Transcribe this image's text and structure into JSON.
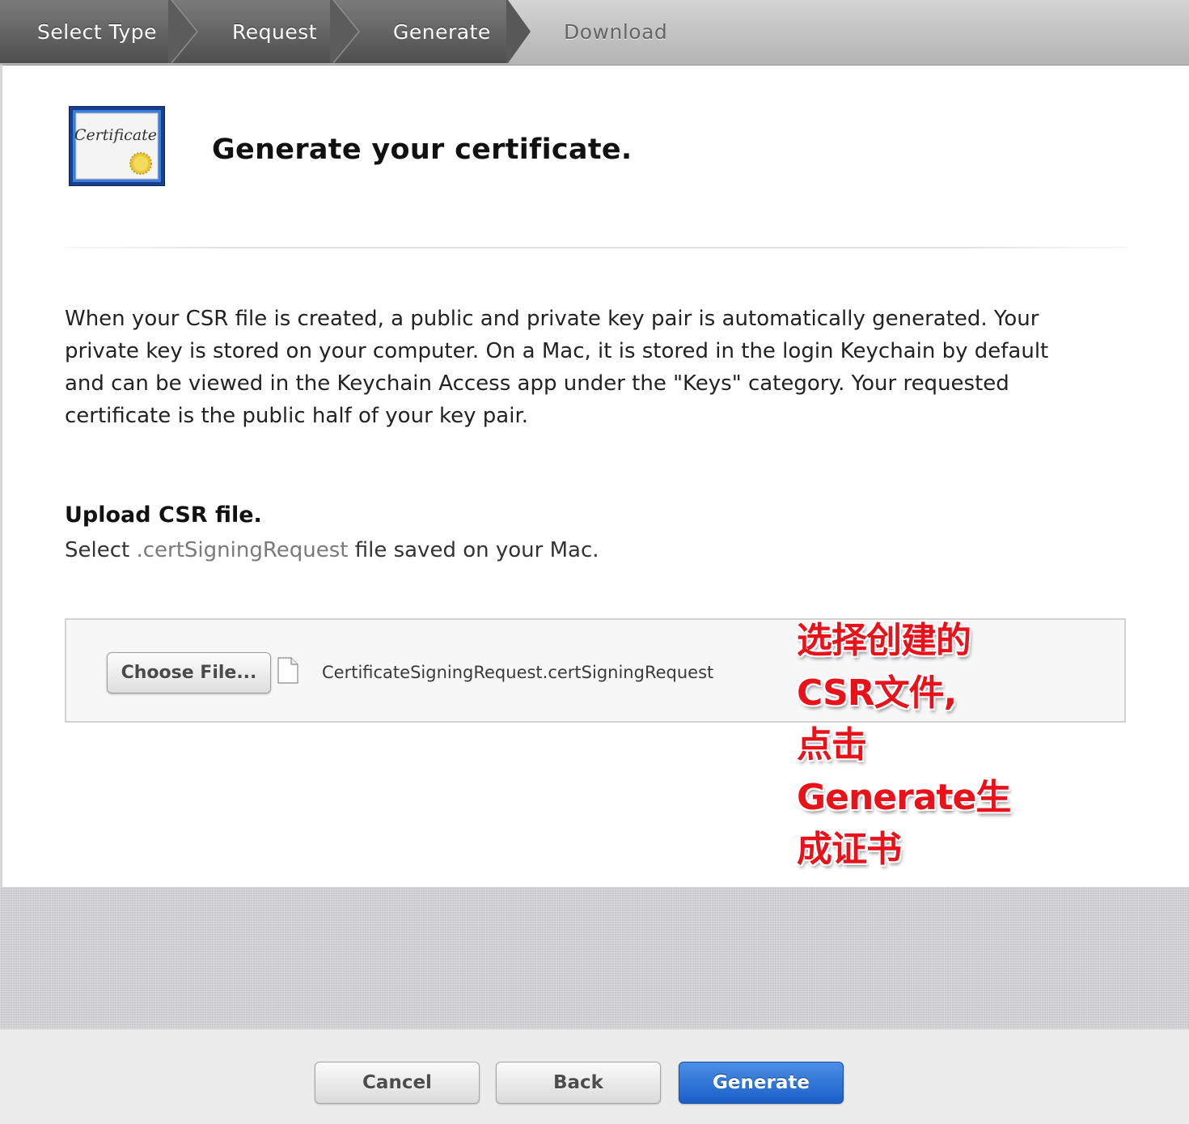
{
  "wizard": {
    "steps": [
      {
        "label": "Select Type",
        "state": "done"
      },
      {
        "label": "Request",
        "state": "done"
      },
      {
        "label": "Generate",
        "state": "done"
      },
      {
        "label": "Download",
        "state": "current"
      }
    ]
  },
  "header": {
    "icon": "certificate-icon",
    "icon_text": "Certificate",
    "title": "Generate your certificate."
  },
  "description": "When your CSR file is created, a public and private key pair is automatically generated. Your private key is stored on your computer. On a Mac, it is stored in the login Keychain by default and can be viewed in the Keychain Access app under the \"Keys\" category. Your requested certificate is the public half of your key pair.",
  "upload": {
    "heading": "Upload CSR file.",
    "sub_prefix": "Select",
    "sub_ext": ".certSigningRequest",
    "sub_suffix": "file saved on your Mac.",
    "choose_button": "Choose File...",
    "file_icon": "document-icon",
    "file_name": "CertificateSigningRequest.certSigningRequest"
  },
  "annotation": {
    "lines": [
      "选择创建的",
      "CSR文件,",
      "点击",
      "Generate生",
      "成证书"
    ],
    "color": "#e8121a"
  },
  "footer": {
    "cancel": "Cancel",
    "back": "Back",
    "generate": "Generate",
    "primary_color": "#1a5fc7"
  }
}
